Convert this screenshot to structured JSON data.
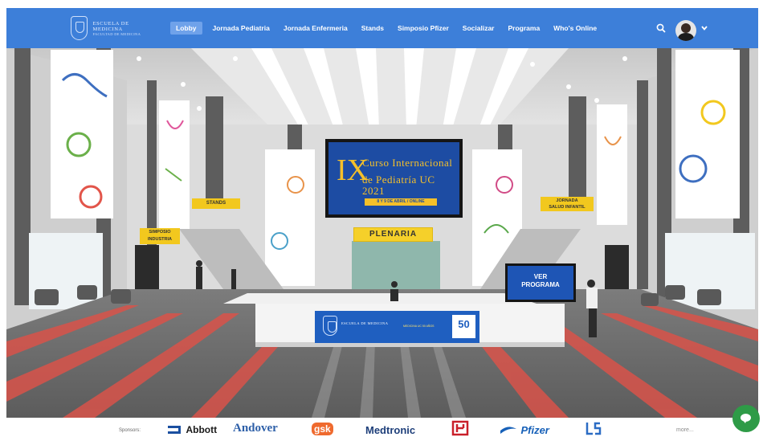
{
  "header": {
    "logo_line1": "ESCUELA DE MEDICINA",
    "logo_line2": "FACULTAD DE MEDICINA",
    "nav": [
      "Lobby",
      "Jornada Pediatria",
      "Jornada Enfermeria",
      "Stands",
      "Simposio Pfizer",
      "Socializar",
      "Programa",
      "Who's Online"
    ],
    "active_nav": "Lobby",
    "icons": [
      "search-icon",
      "avatar",
      "chevron-down-icon"
    ]
  },
  "scene": {
    "screen": {
      "roman": "IX",
      "line1": "Curso Internacional",
      "line2": "de Pediatría UC 2021",
      "date": "8 Y 9 DE ABRIL / ONLINE"
    },
    "plenaria": "PLENARIA",
    "stands": "STANDS",
    "simposio": [
      "SIMPOSIO",
      "INDUSTRIA"
    ],
    "jornada": [
      "JORNADA",
      "SALUD INFANTIL"
    ],
    "ver_programa": [
      "VER",
      "PROGRAMA"
    ],
    "desk": {
      "name": "ESCUELA DE MEDICINA",
      "small": "MEDICINA UC 50 AÑOS",
      "badge": "50"
    }
  },
  "sponsors": {
    "label": "Sponsors:",
    "items": [
      "Abbott",
      "Andover",
      "gsk",
      "Medtronic",
      "Pfizer"
    ],
    "more": "more..."
  },
  "colors": {
    "nav_bar": "#3d7fd9",
    "accent_yellow": "#f2c81e",
    "screen_blue": "#1d4ca3",
    "chat_green": "#2e9b47"
  }
}
